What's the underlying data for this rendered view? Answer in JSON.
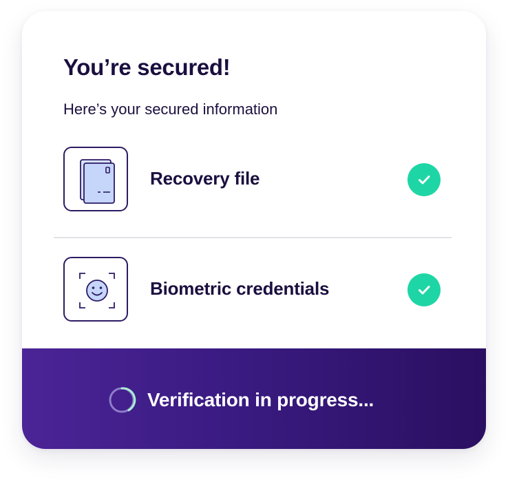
{
  "card": {
    "title": "You’re secured!",
    "subtitle": "Here’s your secured information"
  },
  "items": [
    {
      "label": "Recovery file",
      "icon": "recovery-file-icon",
      "status": "complete"
    },
    {
      "label": "Biometric credentials",
      "icon": "face-scan-icon",
      "status": "complete"
    }
  ],
  "footer": {
    "status_text": "Verification in progress..."
  },
  "colors": {
    "heading": "#1b0f3f",
    "check_bg": "#1ed6a5",
    "footer_start": "#4b2496",
    "footer_end": "#2a0f61",
    "spinner_accent": "#a9f0d2"
  }
}
